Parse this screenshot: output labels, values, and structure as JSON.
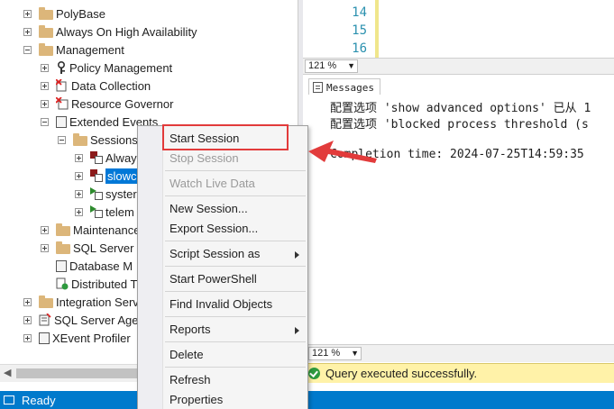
{
  "explorer": {
    "items": [
      {
        "label": "PolyBase",
        "icon": "folder-icon"
      },
      {
        "label": "Always On High Availability",
        "icon": "folder-icon"
      },
      {
        "label": "Management",
        "icon": "folder-icon"
      },
      {
        "label": "Policy Management",
        "icon": "policy-icon"
      },
      {
        "label": "Data Collection",
        "icon": "data-collection-icon"
      },
      {
        "label": "Resource Governor",
        "icon": "resource-governor-icon"
      },
      {
        "label": "Extended Events",
        "icon": "extended-events-icon"
      },
      {
        "label": "Sessions",
        "icon": "folder-icon"
      },
      {
        "label": "Alway",
        "icon": "session-icon"
      },
      {
        "label": "slowc",
        "icon": "session-icon"
      },
      {
        "label": "syster",
        "icon": "session-running-icon"
      },
      {
        "label": "telem",
        "icon": "session-running-icon"
      },
      {
        "label": "Maintenance",
        "icon": "folder-icon"
      },
      {
        "label": "SQL Server L",
        "icon": "folder-icon"
      },
      {
        "label": "Database M",
        "icon": "database-mail-icon"
      },
      {
        "label": "Distributed T",
        "icon": "distributed-icon"
      },
      {
        "label": "Integration Serv",
        "icon": "folder-icon"
      },
      {
        "label": "SQL Server Age",
        "icon": "agent-icon"
      },
      {
        "label": "XEvent Profiler",
        "icon": "xevent-icon"
      }
    ]
  },
  "editor": {
    "line_numbers": [
      "14",
      "15",
      "16"
    ],
    "zoom": "121 %"
  },
  "messages": {
    "tab_label": "Messages",
    "lines": [
      "配置选项 'show advanced options' 已从 1",
      "配置选项 'blocked process threshold (s",
      "Completion time: 2024-07-25T14:59:35"
    ],
    "zoom": "121 %"
  },
  "query_status": "Query executed successfully.",
  "status_bar": "Ready",
  "context_menu": {
    "items": [
      {
        "label": "Start Session",
        "disabled": false
      },
      {
        "label": "Stop Session",
        "disabled": true
      },
      {
        "label": "Watch Live Data",
        "disabled": true
      },
      {
        "label": "New Session...",
        "disabled": false
      },
      {
        "label": "Export Session...",
        "disabled": false
      },
      {
        "label": "Script Session as",
        "disabled": false,
        "submenu": true
      },
      {
        "label": "Start PowerShell",
        "disabled": false
      },
      {
        "label": "Find Invalid Objects",
        "disabled": false
      },
      {
        "label": "Reports",
        "disabled": false,
        "submenu": true
      },
      {
        "label": "Delete",
        "disabled": false
      },
      {
        "label": "Refresh",
        "disabled": false
      },
      {
        "label": "Properties",
        "disabled": false
      }
    ]
  },
  "colors": {
    "annotation": "#e23b3b",
    "status_bar": "#007acc",
    "selection": "#0078d7",
    "success_bar": "#fff2a8"
  }
}
